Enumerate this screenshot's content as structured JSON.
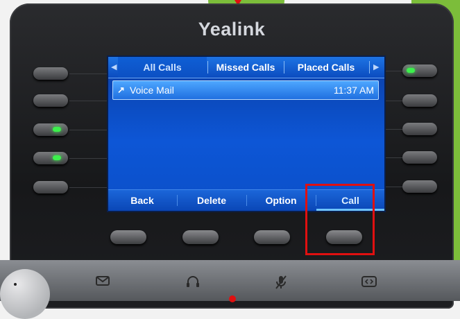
{
  "device": {
    "brand": "Yealink"
  },
  "screen": {
    "tabs": [
      {
        "label": "All Calls",
        "active": true
      },
      {
        "label": "Missed Calls",
        "active": false
      },
      {
        "label": "Placed Calls",
        "active": false
      }
    ],
    "call_list": [
      {
        "icon": "outgoing-call-arrow-icon",
        "name": "Voice Mail",
        "time": "11:37 AM",
        "selected": true
      }
    ],
    "softkeys": [
      {
        "label": "Back"
      },
      {
        "label": "Delete"
      },
      {
        "label": "Option"
      },
      {
        "label": "Call",
        "highlighted": true
      }
    ]
  },
  "line_keys": {
    "left": [
      {
        "led": false
      },
      {
        "led": false
      },
      {
        "led": true
      },
      {
        "led": true
      },
      {
        "led": false
      }
    ],
    "right": [
      {
        "led": true
      },
      {
        "led": false
      },
      {
        "led": false
      },
      {
        "led": false
      },
      {
        "led": false
      }
    ]
  },
  "bottom_icons": [
    "message-icon",
    "headset-icon",
    "mute-mic-icon",
    "transfer-icon"
  ],
  "colors": {
    "screen_blue": "#0d56d6",
    "led_green": "#3cf04c",
    "highlight_red": "#e01010",
    "background_green": "#7cbd3a"
  }
}
